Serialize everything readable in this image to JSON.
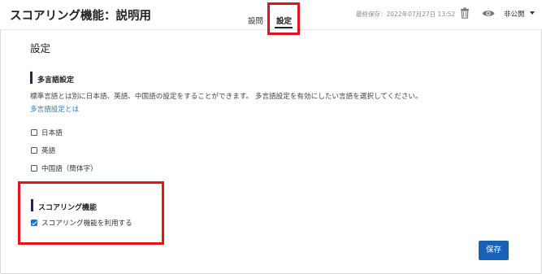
{
  "header": {
    "title": "スコアリング機能：説明用",
    "tabs": [
      {
        "label": "設問"
      },
      {
        "label": "設定",
        "active": true
      }
    ],
    "last_saved": "最終保存：2022年07月27日 13:52",
    "visibility": "非公開"
  },
  "page": {
    "heading": "設定"
  },
  "multilingual": {
    "title": "多言語設定",
    "description": "標準言語とは別に日本語、英語、中国語の設定をすることができます。 多言語設定を有効にしたい言語を選択してください。",
    "help_link": "多言語設定とは",
    "options": [
      {
        "label": "日本語",
        "checked": false
      },
      {
        "label": "英語",
        "checked": false
      },
      {
        "label": "中国語（簡体字）",
        "checked": false
      }
    ]
  },
  "scoring": {
    "title": "スコアリング機能",
    "option": {
      "label": "スコアリング機能を利用する",
      "checked": true
    }
  },
  "actions": {
    "save_label": "保存"
  },
  "colors": {
    "accent": "#1762b8",
    "highlight": "#e3131b",
    "section_bar": "#1b2d55",
    "link": "#3377bb"
  }
}
